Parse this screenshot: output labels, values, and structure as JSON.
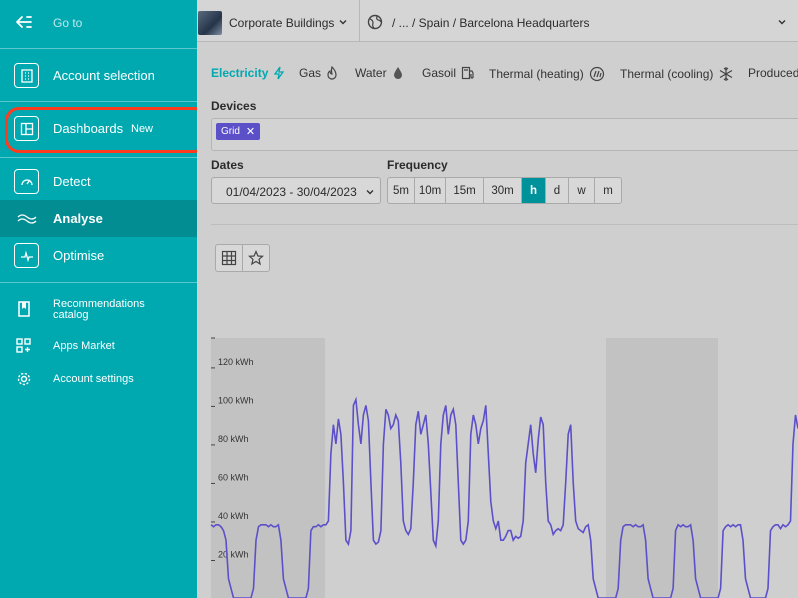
{
  "sidebar": {
    "goto_label": "Go to",
    "items": [
      {
        "label": "Account selection",
        "icon": "building-icon"
      },
      {
        "label": "Dashboards",
        "badge": "New",
        "icon": "dashboard-layout-icon"
      },
      {
        "label": "Detect",
        "icon": "gauge-icon"
      },
      {
        "label": "Analyse",
        "icon": "wave-chart-icon",
        "active": true
      },
      {
        "label": "Optimise",
        "icon": "pulse-icon"
      },
      {
        "label": "Recommendations catalog",
        "icon": "book-icon"
      },
      {
        "label": "Apps Market",
        "icon": "apps-grid-icon"
      },
      {
        "label": "Account settings",
        "icon": "gear-icon"
      }
    ]
  },
  "topbar": {
    "group": "Corporate Buildings",
    "path": "/ ... / Spain / Barcelona Headquarters"
  },
  "tabs": [
    {
      "label": "Electricity",
      "icon": "lightning-icon",
      "active": true
    },
    {
      "label": "Gas",
      "icon": "flame-icon"
    },
    {
      "label": "Water",
      "icon": "droplet-icon"
    },
    {
      "label": "Gasoil",
      "icon": "fuel-pump-icon"
    },
    {
      "label": "Thermal (heating)",
      "icon": "heating-icon"
    },
    {
      "label": "Thermal (cooling)",
      "icon": "snowflake-icon"
    },
    {
      "label": "Produced",
      "icon": ""
    }
  ],
  "devices": {
    "label": "Devices",
    "chips": [
      {
        "label": "Grid"
      }
    ]
  },
  "dates": {
    "label": "Dates",
    "value": "01/04/2023 - 30/04/2023"
  },
  "frequency": {
    "label": "Frequency",
    "options": [
      "5m",
      "10m",
      "15m",
      "30m",
      "h",
      "d",
      "w",
      "m"
    ],
    "selected": "h"
  },
  "colors": {
    "accent": "#00a9b0",
    "series": "#5c50c9",
    "weekend_band": "#c2c2c2"
  },
  "chart_data": {
    "type": "line",
    "ylabel_unit": "kWh",
    "y_ticks": [
      "120 kWh",
      "100 kWh",
      "80 kWh",
      "60 kWh",
      "40 kWh",
      "20 kWh"
    ],
    "y_tick_values": [
      120,
      100,
      80,
      60,
      40,
      20
    ],
    "ylim": [
      0,
      135
    ],
    "series": [
      {
        "values": [
          38,
          37,
          38,
          38,
          37,
          35,
          30,
          10,
          5,
          0,
          0,
          0,
          0,
          0,
          0,
          0,
          0,
          5,
          30,
          37,
          38,
          38,
          38,
          37,
          38,
          37,
          37,
          38,
          30,
          10,
          5,
          0,
          0,
          0,
          0,
          0,
          0,
          0,
          0,
          5,
          35,
          37,
          37,
          38,
          37,
          38,
          38,
          40,
          75,
          90,
          80,
          93,
          85,
          60,
          30,
          28,
          35,
          100,
          103,
          90,
          80,
          95,
          100,
          92,
          60,
          30,
          28,
          29,
          35,
          80,
          98,
          95,
          88,
          90,
          95,
          92,
          70,
          40,
          35,
          33,
          36,
          60,
          90,
          97,
          85,
          90,
          95,
          80,
          55,
          30,
          27,
          40,
          80,
          95,
          100,
          85,
          95,
          98,
          90,
          60,
          30,
          28,
          30,
          40,
          85,
          95,
          90,
          80,
          88,
          92,
          100,
          75,
          50,
          40,
          36,
          40,
          30,
          30,
          32,
          35,
          35,
          30,
          32,
          31,
          32,
          40,
          70,
          80,
          90,
          75,
          65,
          82,
          94,
          90,
          60,
          40,
          38,
          33,
          35,
          36,
          35,
          38,
          60,
          85,
          90,
          60,
          40,
          36,
          35,
          34,
          37,
          38,
          30,
          10,
          5,
          0,
          0,
          0,
          0,
          0,
          0,
          0,
          0,
          5,
          30,
          37,
          38,
          38,
          38,
          37,
          38,
          37,
          37,
          38,
          30,
          10,
          5,
          0,
          0,
          0,
          0,
          0,
          0,
          0,
          0,
          5,
          35,
          38,
          37,
          38,
          37,
          37,
          38,
          30,
          10,
          5,
          0,
          0,
          0,
          0,
          0,
          0,
          0,
          0,
          5,
          35,
          37,
          38,
          37,
          38,
          37,
          38,
          38,
          30,
          10,
          5,
          0,
          0,
          0,
          0,
          0,
          0,
          0,
          5,
          35,
          37,
          38,
          38,
          36,
          38,
          37,
          38,
          40,
          80,
          95,
          88
        ]
      }
    ]
  }
}
